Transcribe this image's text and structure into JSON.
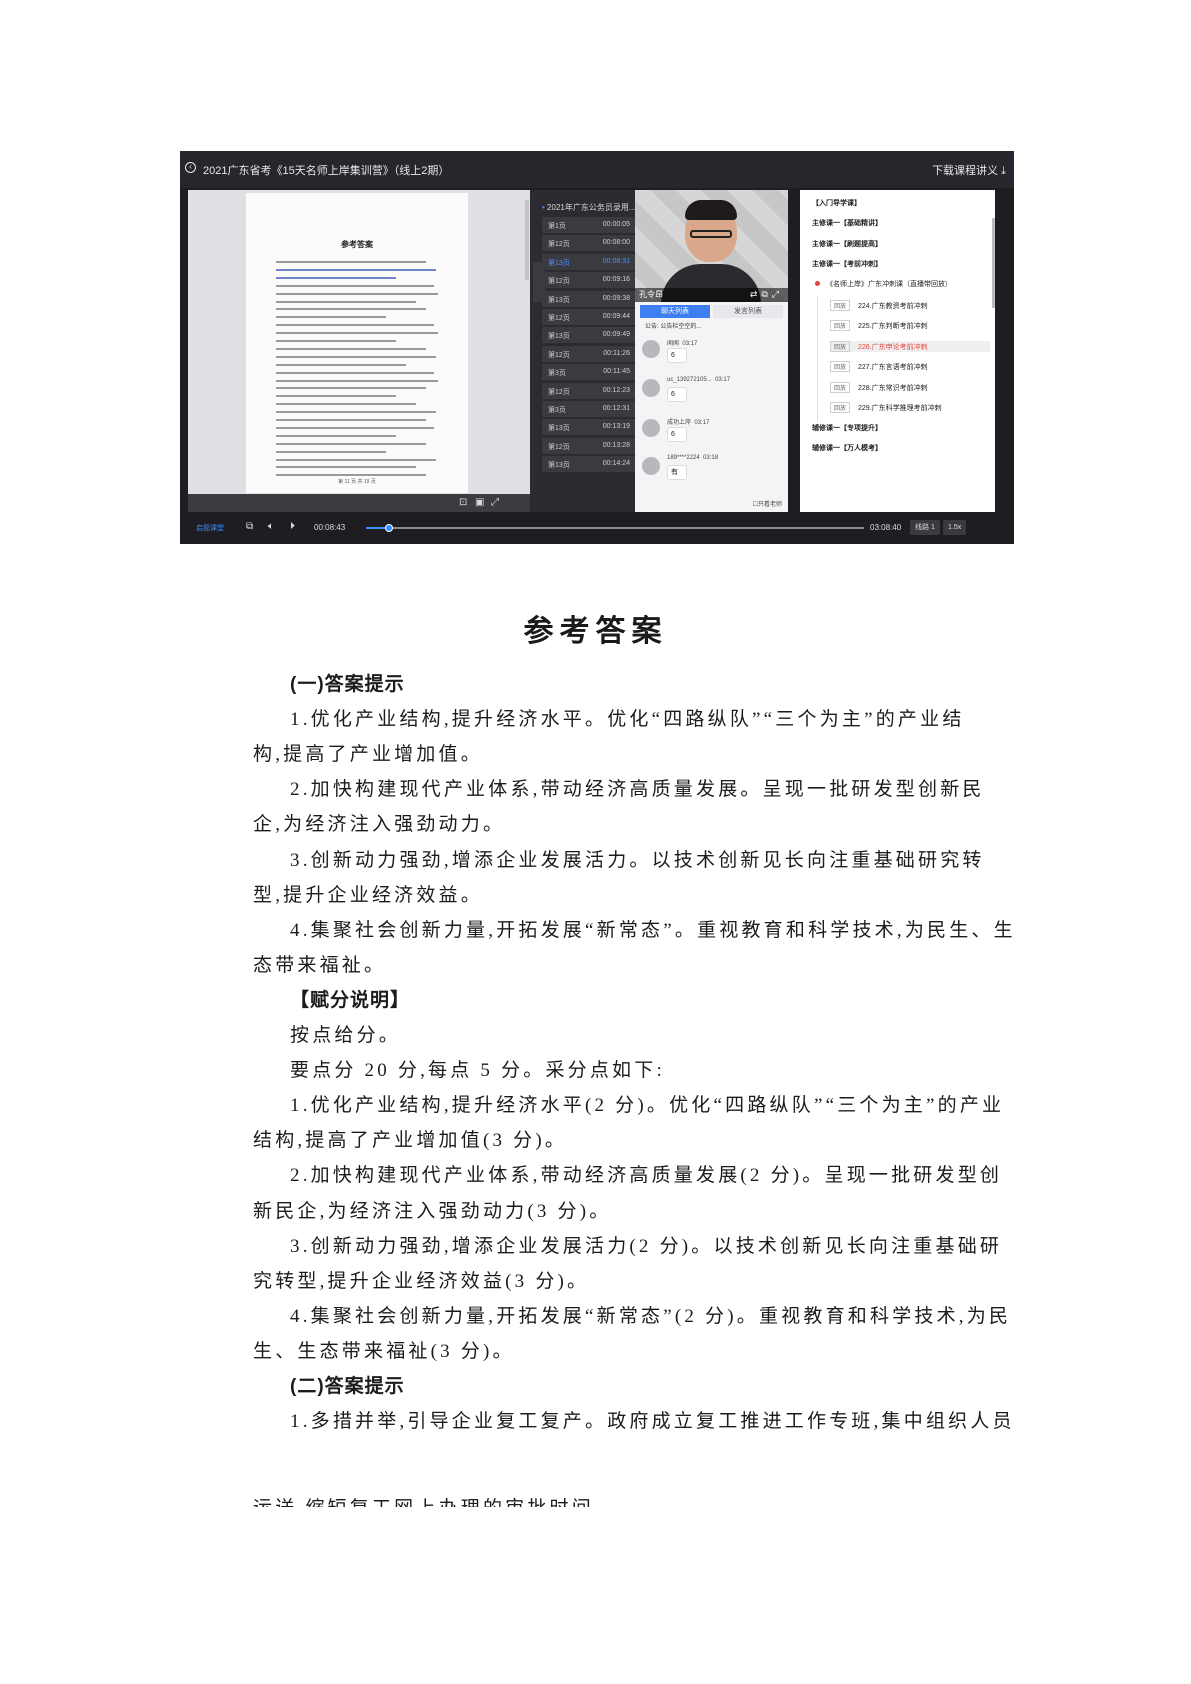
{
  "window": {
    "title": "2021广东省考《15天名师上岸集训营》（线上2期）",
    "download_label": "下载课程讲义"
  },
  "doc_preview": {
    "title": "参考答案",
    "footer": "第 11 页   共 19 页"
  },
  "playlist": {
    "header": "2021年广东公务员录用...",
    "items": [
      {
        "label": "第1页",
        "time": "00:00:05"
      },
      {
        "label": "第12页",
        "time": "00:08:00"
      },
      {
        "label": "第13页",
        "time": "00:08:31",
        "active": true
      },
      {
        "label": "第12页",
        "time": "00:09:16"
      },
      {
        "label": "第13页",
        "time": "00:09:38"
      },
      {
        "label": "第12页",
        "time": "00:09:44"
      },
      {
        "label": "第13页",
        "time": "00:09:49"
      },
      {
        "label": "第12页",
        "time": "00:11:26"
      },
      {
        "label": "第3页",
        "time": "00:11:45"
      },
      {
        "label": "第12页",
        "time": "00:12:23"
      },
      {
        "label": "第3页",
        "time": "00:12:31"
      },
      {
        "label": "第13页",
        "time": "00:13:19"
      },
      {
        "label": "第12页",
        "time": "00:13:28"
      },
      {
        "label": "第13页",
        "time": "00:14:24"
      }
    ]
  },
  "video": {
    "teacher_name": "孔令昂"
  },
  "chat": {
    "tab_chat": "聊天列表",
    "tab_speakers": "发言列表",
    "notice": "公告: 公告栏空空的...",
    "messages": [
      {
        "name": "闻闻",
        "time": "03:17",
        "text": "6"
      },
      {
        "name": "uc_139272105...",
        "time": "03:17",
        "text": "6"
      },
      {
        "name": "成功上岸",
        "time": "03:17",
        "text": "6"
      },
      {
        "name": "189****2224",
        "time": "03:18",
        "text": "有"
      }
    ],
    "only_teacher": "只看老师"
  },
  "curriculum": {
    "items": [
      {
        "text": "【入门导学课】",
        "kind": "section"
      },
      {
        "text": "主修课一【基础精讲】",
        "kind": "section"
      },
      {
        "text": "主修课一【刷题提高】",
        "kind": "section"
      },
      {
        "text": "主修课一【考前冲刺】",
        "kind": "section"
      },
      {
        "text": "《名师上岸》广东冲刺课（直播带回放）",
        "kind": "group"
      },
      {
        "tag": "回放",
        "text": "224.广东教资考前冲刺",
        "kind": "lesson"
      },
      {
        "tag": "回放",
        "text": "225.广东判断考前冲刺",
        "kind": "lesson"
      },
      {
        "tag": "回放",
        "text": "226.广东申论考前冲刺",
        "kind": "lesson",
        "selected": true
      },
      {
        "tag": "回放",
        "text": "227.广东言语考前冲刺",
        "kind": "lesson"
      },
      {
        "tag": "回放",
        "text": "228.广东常识考前冲刺",
        "kind": "lesson"
      },
      {
        "tag": "回放",
        "text": "229.广东科学推理考前冲刺",
        "kind": "lesson"
      },
      {
        "text": "辅修课一【专项提升】",
        "kind": "section"
      },
      {
        "text": "辅修课一【万人模考】",
        "kind": "section"
      }
    ]
  },
  "player": {
    "current_time": "00:08:43",
    "total_time": "03:08:40",
    "progress": 0.046,
    "line_label": "线路 1",
    "speed_label": "1.5x",
    "brand": "启题课堂"
  },
  "document": {
    "title": "参考答案",
    "lines": [
      {
        "type": "head",
        "text": "(一)答案提示"
      },
      {
        "type": "indent",
        "text": "1.优化产业结构,提升经济水平。优化“四路纵队”“三个为主”的产业结"
      },
      {
        "type": "body",
        "text": "构,提高了产业增加值。"
      },
      {
        "type": "indent",
        "text": "2.加快构建现代产业体系,带动经济高质量发展。呈现一批研发型创新民"
      },
      {
        "type": "body",
        "text": "企,为经济注入强劲动力。"
      },
      {
        "type": "indent",
        "text": "3.创新动力强劲,增添企业发展活力。以技术创新见长向注重基础研究转"
      },
      {
        "type": "body",
        "text": "型,提升企业经济效益。"
      },
      {
        "type": "indent",
        "text": "4.集聚社会创新力量,开拓发展“新常态”。重视教育和科学技术,为民生、生"
      },
      {
        "type": "body",
        "text": "态带来福祉。"
      },
      {
        "type": "head",
        "text": "【赋分说明】"
      },
      {
        "type": "indent",
        "text": "按点给分。"
      },
      {
        "type": "indent",
        "text": "要点分 20 分,每点 5 分。采分点如下:"
      },
      {
        "type": "indent",
        "text": "1.优化产业结构,提升经济水平(2 分)。优化“四路纵队”“三个为主”的产业"
      },
      {
        "type": "body",
        "text": "结构,提高了产业增加值(3 分)。"
      },
      {
        "type": "indent",
        "text": "2.加快构建现代产业体系,带动经济高质量发展(2 分)。呈现一批研发型创"
      },
      {
        "type": "body",
        "text": "新民企,为经济注入强劲动力(3 分)。"
      },
      {
        "type": "indent",
        "text": "3.创新动力强劲,增添企业发展活力(2 分)。以技术创新见长向注重基础研"
      },
      {
        "type": "body",
        "text": "究转型,提升企业经济效益(3 分)。"
      },
      {
        "type": "indent",
        "text": "4.集聚社会创新力量,开拓发展“新常态”(2 分)。重视教育和科学技术,为民"
      },
      {
        "type": "body",
        "text": "生、生态带来福祉(3 分)。"
      },
      {
        "type": "head",
        "text": "(二)答案提示"
      },
      {
        "type": "indent",
        "text": "1.多措并举,引导企业复工复产。政府成立复工推进工作专班,集中组织人员"
      }
    ],
    "cut_line": "运送,缩短复工网上办理的审批时间"
  }
}
